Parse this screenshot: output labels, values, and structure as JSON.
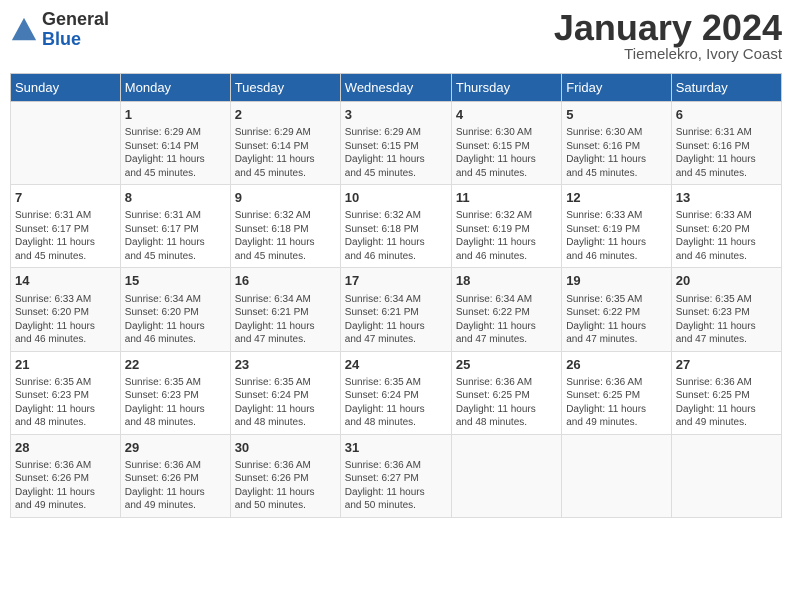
{
  "header": {
    "logo_line1": "General",
    "logo_line2": "Blue",
    "month": "January 2024",
    "location": "Tiemelekro, Ivory Coast"
  },
  "weekdays": [
    "Sunday",
    "Monday",
    "Tuesday",
    "Wednesday",
    "Thursday",
    "Friday",
    "Saturday"
  ],
  "weeks": [
    [
      {
        "day": "",
        "info": ""
      },
      {
        "day": "1",
        "info": "Sunrise: 6:29 AM\nSunset: 6:14 PM\nDaylight: 11 hours\nand 45 minutes."
      },
      {
        "day": "2",
        "info": "Sunrise: 6:29 AM\nSunset: 6:14 PM\nDaylight: 11 hours\nand 45 minutes."
      },
      {
        "day": "3",
        "info": "Sunrise: 6:29 AM\nSunset: 6:15 PM\nDaylight: 11 hours\nand 45 minutes."
      },
      {
        "day": "4",
        "info": "Sunrise: 6:30 AM\nSunset: 6:15 PM\nDaylight: 11 hours\nand 45 minutes."
      },
      {
        "day": "5",
        "info": "Sunrise: 6:30 AM\nSunset: 6:16 PM\nDaylight: 11 hours\nand 45 minutes."
      },
      {
        "day": "6",
        "info": "Sunrise: 6:31 AM\nSunset: 6:16 PM\nDaylight: 11 hours\nand 45 minutes."
      }
    ],
    [
      {
        "day": "7",
        "info": "Sunrise: 6:31 AM\nSunset: 6:17 PM\nDaylight: 11 hours\nand 45 minutes."
      },
      {
        "day": "8",
        "info": "Sunrise: 6:31 AM\nSunset: 6:17 PM\nDaylight: 11 hours\nand 45 minutes."
      },
      {
        "day": "9",
        "info": "Sunrise: 6:32 AM\nSunset: 6:18 PM\nDaylight: 11 hours\nand 45 minutes."
      },
      {
        "day": "10",
        "info": "Sunrise: 6:32 AM\nSunset: 6:18 PM\nDaylight: 11 hours\nand 46 minutes."
      },
      {
        "day": "11",
        "info": "Sunrise: 6:32 AM\nSunset: 6:19 PM\nDaylight: 11 hours\nand 46 minutes."
      },
      {
        "day": "12",
        "info": "Sunrise: 6:33 AM\nSunset: 6:19 PM\nDaylight: 11 hours\nand 46 minutes."
      },
      {
        "day": "13",
        "info": "Sunrise: 6:33 AM\nSunset: 6:20 PM\nDaylight: 11 hours\nand 46 minutes."
      }
    ],
    [
      {
        "day": "14",
        "info": "Sunrise: 6:33 AM\nSunset: 6:20 PM\nDaylight: 11 hours\nand 46 minutes."
      },
      {
        "day": "15",
        "info": "Sunrise: 6:34 AM\nSunset: 6:20 PM\nDaylight: 11 hours\nand 46 minutes."
      },
      {
        "day": "16",
        "info": "Sunrise: 6:34 AM\nSunset: 6:21 PM\nDaylight: 11 hours\nand 47 minutes."
      },
      {
        "day": "17",
        "info": "Sunrise: 6:34 AM\nSunset: 6:21 PM\nDaylight: 11 hours\nand 47 minutes."
      },
      {
        "day": "18",
        "info": "Sunrise: 6:34 AM\nSunset: 6:22 PM\nDaylight: 11 hours\nand 47 minutes."
      },
      {
        "day": "19",
        "info": "Sunrise: 6:35 AM\nSunset: 6:22 PM\nDaylight: 11 hours\nand 47 minutes."
      },
      {
        "day": "20",
        "info": "Sunrise: 6:35 AM\nSunset: 6:23 PM\nDaylight: 11 hours\nand 47 minutes."
      }
    ],
    [
      {
        "day": "21",
        "info": "Sunrise: 6:35 AM\nSunset: 6:23 PM\nDaylight: 11 hours\nand 48 minutes."
      },
      {
        "day": "22",
        "info": "Sunrise: 6:35 AM\nSunset: 6:23 PM\nDaylight: 11 hours\nand 48 minutes."
      },
      {
        "day": "23",
        "info": "Sunrise: 6:35 AM\nSunset: 6:24 PM\nDaylight: 11 hours\nand 48 minutes."
      },
      {
        "day": "24",
        "info": "Sunrise: 6:35 AM\nSunset: 6:24 PM\nDaylight: 11 hours\nand 48 minutes."
      },
      {
        "day": "25",
        "info": "Sunrise: 6:36 AM\nSunset: 6:25 PM\nDaylight: 11 hours\nand 48 minutes."
      },
      {
        "day": "26",
        "info": "Sunrise: 6:36 AM\nSunset: 6:25 PM\nDaylight: 11 hours\nand 49 minutes."
      },
      {
        "day": "27",
        "info": "Sunrise: 6:36 AM\nSunset: 6:25 PM\nDaylight: 11 hours\nand 49 minutes."
      }
    ],
    [
      {
        "day": "28",
        "info": "Sunrise: 6:36 AM\nSunset: 6:26 PM\nDaylight: 11 hours\nand 49 minutes."
      },
      {
        "day": "29",
        "info": "Sunrise: 6:36 AM\nSunset: 6:26 PM\nDaylight: 11 hours\nand 49 minutes."
      },
      {
        "day": "30",
        "info": "Sunrise: 6:36 AM\nSunset: 6:26 PM\nDaylight: 11 hours\nand 50 minutes."
      },
      {
        "day": "31",
        "info": "Sunrise: 6:36 AM\nSunset: 6:27 PM\nDaylight: 11 hours\nand 50 minutes."
      },
      {
        "day": "",
        "info": ""
      },
      {
        "day": "",
        "info": ""
      },
      {
        "day": "",
        "info": ""
      }
    ]
  ]
}
